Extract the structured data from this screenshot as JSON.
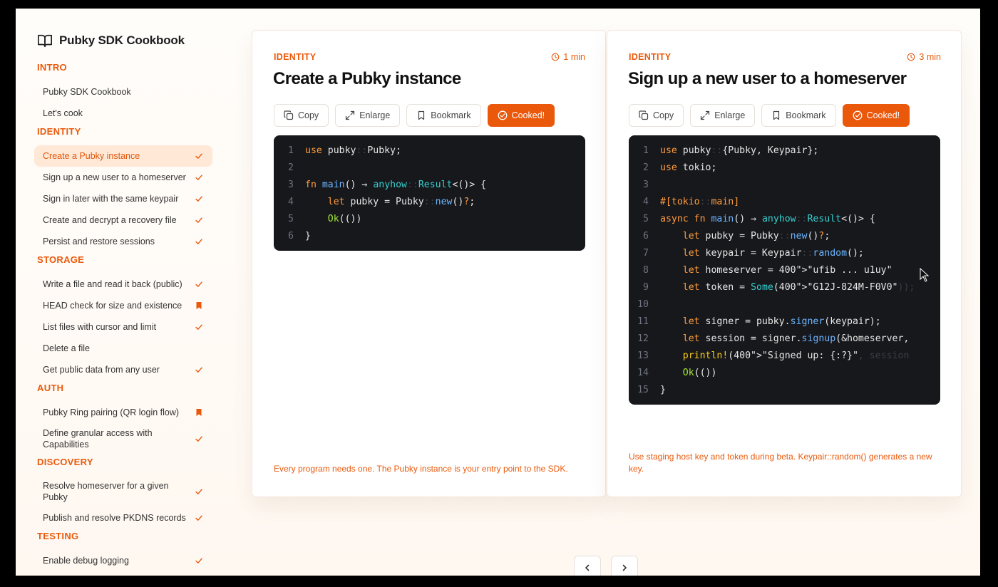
{
  "app": {
    "title": "Pubky SDK Cookbook"
  },
  "sidebar": {
    "sections": [
      {
        "label": "INTRO",
        "items": [
          {
            "label": "Pubky SDK Cookbook",
            "mark": "none"
          },
          {
            "label": "Let's cook",
            "mark": "none"
          }
        ]
      },
      {
        "label": "IDENTITY",
        "items": [
          {
            "label": "Create a Pubky instance",
            "mark": "check",
            "active": true
          },
          {
            "label": "Sign up a new user to a homeserver",
            "mark": "check"
          },
          {
            "label": "Sign in later with the same keypair",
            "mark": "check"
          },
          {
            "label": "Create and decrypt a recovery file",
            "mark": "check"
          },
          {
            "label": "Persist and restore sessions",
            "mark": "check"
          }
        ]
      },
      {
        "label": "STORAGE",
        "items": [
          {
            "label": "Write a file and read it back (public)",
            "mark": "check"
          },
          {
            "label": "HEAD check for size and existence",
            "mark": "bookmark"
          },
          {
            "label": "List files with cursor and limit",
            "mark": "check"
          },
          {
            "label": "Delete a file",
            "mark": "none"
          },
          {
            "label": "Get public data from any user",
            "mark": "check"
          }
        ]
      },
      {
        "label": "AUTH",
        "items": [
          {
            "label": "Pubky Ring pairing (QR login flow)",
            "mark": "bookmark"
          },
          {
            "label": "Define granular access with Capabilities",
            "mark": "check",
            "tall": true
          }
        ]
      },
      {
        "label": "DISCOVERY",
        "items": [
          {
            "label": "Resolve homeserver for a given Pubky",
            "mark": "check",
            "tall": true
          },
          {
            "label": "Publish and resolve PKDNS records",
            "mark": "check"
          }
        ]
      },
      {
        "label": "TESTING",
        "items": [
          {
            "label": "Enable debug logging",
            "mark": "check"
          },
          {
            "label": "Run an embedded local testnet",
            "mark": "check"
          }
        ]
      }
    ]
  },
  "buttons": {
    "copy": "Copy",
    "enlarge": "Enlarge",
    "bookmark": "Bookmark",
    "cooked": "Cooked!"
  },
  "cards": [
    {
      "category": "IDENTITY",
      "time": "1 min",
      "title": "Create a Pubky instance",
      "note": "Every program needs one. The Pubky instance is your entry point to the SDK.",
      "code": [
        [
          [
            "kw",
            "use"
          ],
          [
            "src",
            " pubky"
          ],
          [
            "dim",
            "::"
          ],
          [
            "src",
            "Pubky;"
          ]
        ],
        [],
        [
          [
            "kw",
            "fn"
          ],
          [
            "src",
            " "
          ],
          [
            "fn",
            "main"
          ],
          [
            "src",
            "() → "
          ],
          [
            "ty",
            "anyhow"
          ],
          [
            "dim",
            "::"
          ],
          [
            "ty",
            "Result"
          ],
          [
            "src",
            "<()> {"
          ]
        ],
        [
          [
            "src",
            "    "
          ],
          [
            "kw",
            "let"
          ],
          [
            "src",
            " pubky = Pubky"
          ],
          [
            "dim",
            "::"
          ],
          [
            "fn",
            "new"
          ],
          [
            "src",
            "()"
          ],
          [
            "kw",
            "?"
          ],
          [
            "src",
            ";"
          ]
        ],
        [
          [
            "src",
            "    "
          ],
          [
            "ok",
            "Ok"
          ],
          [
            "src",
            "(())"
          ]
        ],
        [
          [
            "src",
            "}"
          ]
        ]
      ]
    },
    {
      "category": "IDENTITY",
      "time": "3 min",
      "title": "Sign up a new user to a homeserver",
      "note": "Use staging host key and token during beta. Keypair::random() generates a new key.",
      "code": [
        [
          [
            "kw",
            "use"
          ],
          [
            "src",
            " pubky"
          ],
          [
            "dim",
            "::"
          ],
          [
            "src",
            "{Pubky, Keypair};"
          ]
        ],
        [
          [
            "kw",
            "use"
          ],
          [
            "src",
            " tokio;"
          ]
        ],
        [],
        [
          [
            "attr",
            "#[tokio"
          ],
          [
            "dim",
            "::"
          ],
          [
            "attr",
            "main]"
          ]
        ],
        [
          [
            "kw",
            "async fn"
          ],
          [
            "src",
            " "
          ],
          [
            "fn",
            "main"
          ],
          [
            "src",
            "() → "
          ],
          [
            "ty",
            "anyhow"
          ],
          [
            "dim",
            "::"
          ],
          [
            "ty",
            "Result"
          ],
          [
            "src",
            "<()> {"
          ]
        ],
        [
          [
            "src",
            "    "
          ],
          [
            "kw",
            "let"
          ],
          [
            "src",
            " pubky = Pubky"
          ],
          [
            "dim",
            "::"
          ],
          [
            "fn",
            "new"
          ],
          [
            "src",
            "()"
          ],
          [
            "kw",
            "?"
          ],
          [
            "src",
            ";"
          ]
        ],
        [
          [
            "src",
            "    "
          ],
          [
            "kw",
            "let"
          ],
          [
            "src",
            " keypair = Keypair"
          ],
          [
            "dim",
            "::"
          ],
          [
            "fn",
            "random"
          ],
          [
            "src",
            "();"
          ]
        ],
        [
          [
            "src",
            "    "
          ],
          [
            "kw",
            "let"
          ],
          [
            "src",
            " homeserver = 400\">\"ufib ... u1uy\""
          ]
        ],
        [
          [
            "src",
            "    "
          ],
          [
            "kw",
            "let"
          ],
          [
            "src",
            " token = "
          ],
          [
            "ty",
            "Some"
          ],
          [
            "src",
            "(400\">\"G12J-824M-F0V0\""
          ],
          [
            "dim",
            "));"
          ]
        ],
        [],
        [
          [
            "src",
            "    "
          ],
          [
            "kw",
            "let"
          ],
          [
            "src",
            " signer = pubky."
          ],
          [
            "fn",
            "signer"
          ],
          [
            "src",
            "(keypair);"
          ]
        ],
        [
          [
            "src",
            "    "
          ],
          [
            "kw",
            "let"
          ],
          [
            "src",
            " session = signer."
          ],
          [
            "fn",
            "signup"
          ],
          [
            "src",
            "(&homeserver,"
          ]
        ],
        [
          [
            "src",
            "    "
          ],
          [
            "mc",
            "println!"
          ],
          [
            "src",
            "(400\">\"Signed up: {:?}\""
          ],
          [
            "dim",
            ", session"
          ]
        ],
        [
          [
            "src",
            "    "
          ],
          [
            "ok",
            "Ok"
          ],
          [
            "src",
            "(())"
          ]
        ],
        [
          [
            "src",
            "}"
          ]
        ]
      ]
    }
  ],
  "pager": {
    "prev": "‹",
    "next": "›"
  }
}
